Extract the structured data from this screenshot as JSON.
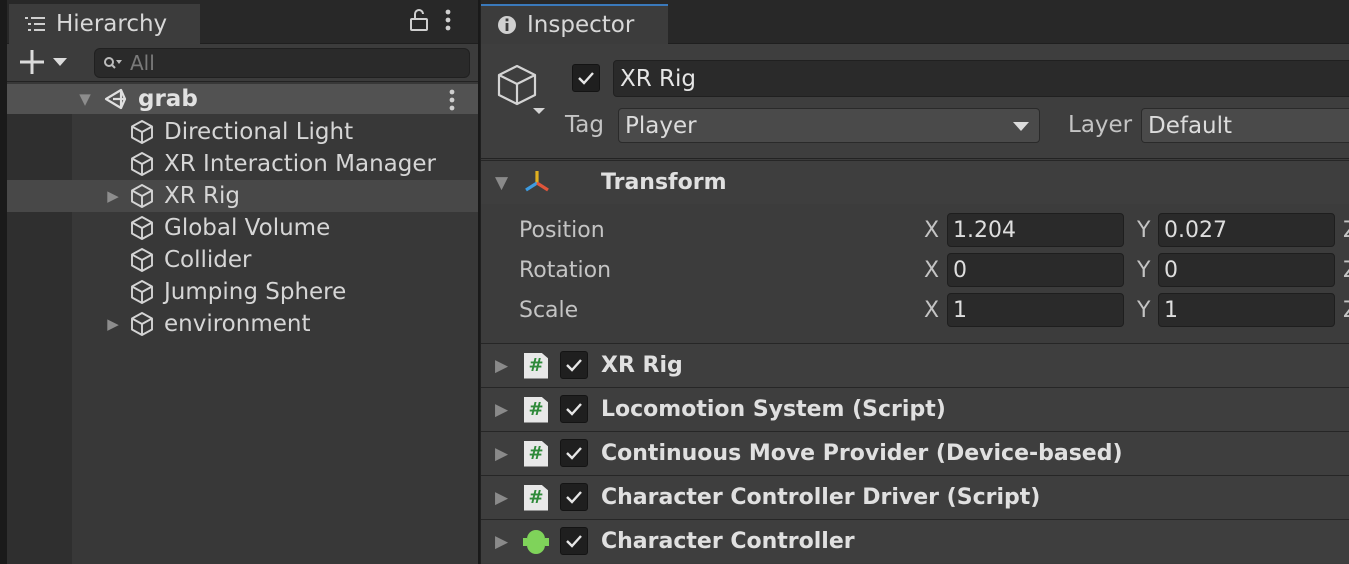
{
  "hierarchy": {
    "tab_label": "Hierarchy",
    "search_placeholder": "All",
    "scene": {
      "name": "grab"
    },
    "items": [
      {
        "label": "Directional Light",
        "expandable": false
      },
      {
        "label": "XR Interaction Manager",
        "expandable": false
      },
      {
        "label": "XR Rig",
        "expandable": true,
        "selected": true
      },
      {
        "label": "Global Volume",
        "expandable": false
      },
      {
        "label": "Collider",
        "expandable": false
      },
      {
        "label": "Jumping Sphere",
        "expandable": false
      },
      {
        "label": "environment",
        "expandable": true
      }
    ]
  },
  "inspector": {
    "tab_label": "Inspector",
    "object_name": "XR Rig",
    "active": true,
    "tag_label": "Tag",
    "tag_value": "Player",
    "layer_label": "Layer",
    "layer_value": "Default",
    "transform": {
      "title": "Transform",
      "rows": [
        {
          "label": "Position",
          "x": "1.204",
          "y": "0.027"
        },
        {
          "label": "Rotation",
          "x": "0",
          "y": "0"
        },
        {
          "label": "Scale",
          "x": "1",
          "y": "1"
        }
      ],
      "axis_x": "X",
      "axis_y": "Y",
      "axis_z": "Z"
    },
    "components": [
      {
        "title": "XR Rig",
        "icon": "script-icon",
        "enabled": true
      },
      {
        "title": "Locomotion System (Script)",
        "icon": "script-icon",
        "enabled": true
      },
      {
        "title": "Continuous Move Provider (Device-based)",
        "icon": "script-icon",
        "enabled": true
      },
      {
        "title": "Character Controller Driver (Script)",
        "icon": "script-icon",
        "enabled": true
      },
      {
        "title": "Character Controller",
        "icon": "capsule-icon",
        "enabled": true
      }
    ]
  },
  "colors": {
    "panel": "#383838",
    "selected_row": "#484848",
    "scene_row": "#525252",
    "tab_accent": "#3a79bb",
    "script_hash": "#2f8a3a",
    "capsule": "#7fd35a"
  }
}
